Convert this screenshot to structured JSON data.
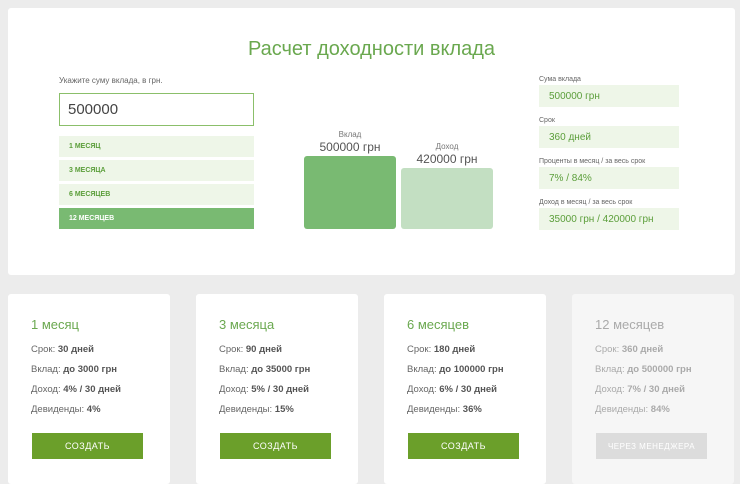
{
  "calculator": {
    "title": "Расчет доходности вклада",
    "amount_label": "Укажите суму вклада, в грн.",
    "amount_value": "500000",
    "periods": [
      "1 МЕСЯЦ",
      "3 МЕСЯЦА",
      "6 МЕСЯЦЕВ",
      "12 МЕСЯЦЕВ"
    ],
    "selected_period_index": 3,
    "chart": {
      "deposit_label": "Вклад",
      "deposit_value_text": "500000 грн",
      "deposit_value": 500000,
      "income_label": "Доход",
      "income_value_text": "420000 грн",
      "income_value": 420000,
      "deposit_color": "#79ba72",
      "income_color": "#c3dfc2"
    },
    "summary": [
      {
        "label": "Сума вклада",
        "value": "500000 грн"
      },
      {
        "label": "Срок",
        "value": "360 дней"
      },
      {
        "label": "Проценты в месяц / за весь срок",
        "value": "7% / 84%"
      },
      {
        "label": "Доход в месяц / за весь срок",
        "value": "35000 грн / 420000 грн"
      }
    ]
  },
  "plans": [
    {
      "title": "1 месяц",
      "term_label": "Срок:",
      "term": "30 дней",
      "deposit_label": "Вклад:",
      "deposit": "до 3000 грн",
      "income_label": "Доход:",
      "income": "4% / 30 дней",
      "dividends_label": "Девиденды:",
      "dividends": "4%",
      "button": "СОЗДАТЬ"
    },
    {
      "title": "3 месяца",
      "term_label": "Срок:",
      "term": "90 дней",
      "deposit_label": "Вклад:",
      "deposit": "до 35000 грн",
      "income_label": "Доход:",
      "income": "5% / 30 дней",
      "dividends_label": "Девиденды:",
      "dividends": "15%",
      "button": "СОЗДАТЬ"
    },
    {
      "title": "6 месяцев",
      "term_label": "Срок:",
      "term": "180 дней",
      "deposit_label": "Вклад:",
      "deposit": "до 100000 грн",
      "income_label": "Доход:",
      "income": "6% / 30 дней",
      "dividends_label": "Девиденды:",
      "dividends": "36%",
      "button": "СОЗДАТЬ"
    },
    {
      "title": "12 месяцев",
      "term_label": "Срок:",
      "term": "360 дней",
      "deposit_label": "Вклад:",
      "deposit": "до 500000 грн",
      "income_label": "Доход:",
      "income": "7% / 30 дней",
      "dividends_label": "Девиденды:",
      "dividends": "84%",
      "button": "ЧЕРЕЗ МЕНЕДЖЕРА"
    }
  ],
  "colors": {
    "accent_green": "#6aa84f",
    "button_green": "#6b9f2a",
    "light_green_bg": "#eef6e8",
    "active_period": "#79ba72"
  }
}
